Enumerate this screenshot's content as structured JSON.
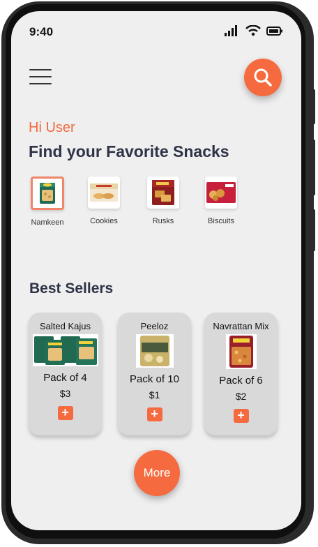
{
  "status": {
    "time": "9:40"
  },
  "greeting": "Hi User",
  "headline": "Find your Favorite Snacks",
  "categories": [
    {
      "label": "Namkeen",
      "selected": true
    },
    {
      "label": "Cookies",
      "selected": false
    },
    {
      "label": "Rusks",
      "selected": false
    },
    {
      "label": "Biscuits",
      "selected": false
    }
  ],
  "best_sellers": {
    "title": "Best Sellers",
    "items": [
      {
        "name": "Salted Kajus",
        "pack": "Pack of 4",
        "price": "$3",
        "add": "+"
      },
      {
        "name": "Peeloz",
        "pack": "Pack of 10",
        "price": "$1",
        "add": "+"
      },
      {
        "name": "Navrattan Mix",
        "pack": "Pack of 6",
        "price": "$2",
        "add": "+"
      }
    ]
  },
  "more_button": "More",
  "colors": {
    "accent": "#f56b3f",
    "greeting": "#f06a3f",
    "heading": "#2f3346",
    "background": "#efefef",
    "card": "#d9d9d9"
  }
}
